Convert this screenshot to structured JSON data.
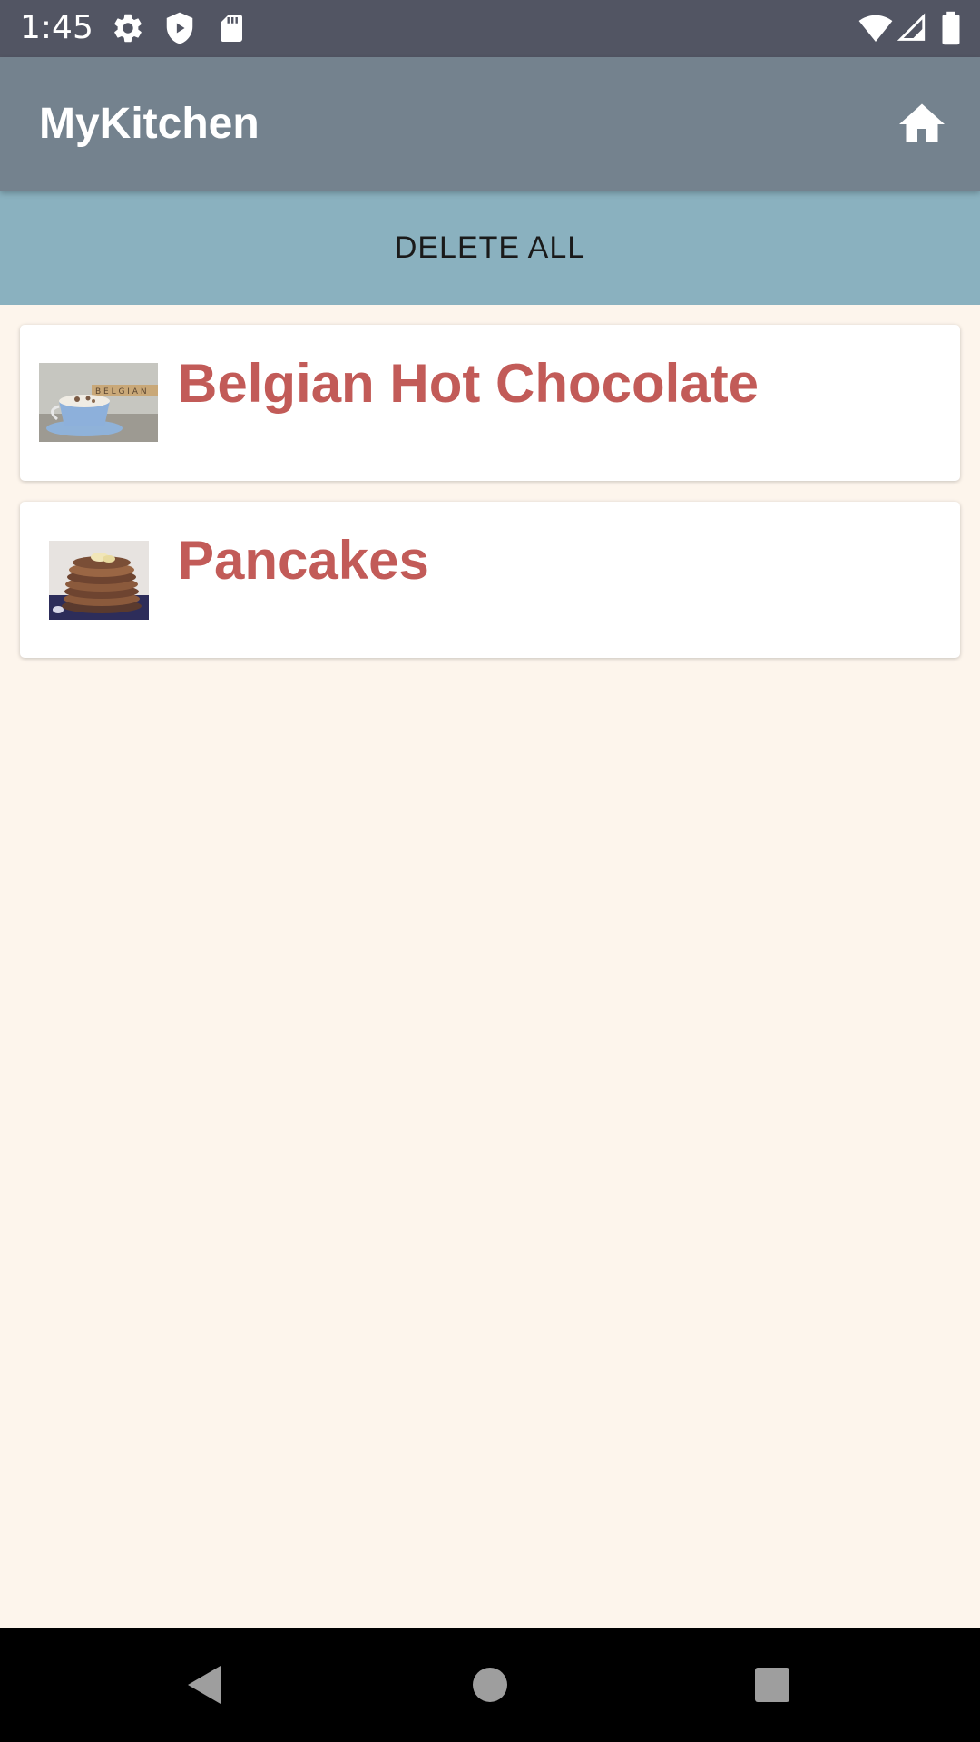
{
  "status_bar": {
    "time": "1:45",
    "icons": [
      "settings-icon",
      "shield-icon",
      "sd-card-icon",
      "wifi-icon",
      "signal-icon",
      "battery-icon"
    ]
  },
  "app_bar": {
    "title": "MyKitchen",
    "home_icon": "home-icon"
  },
  "actions": {
    "delete_all_label": "DELETE ALL"
  },
  "recipes": [
    {
      "title": "Belgian Hot Chocolate",
      "thumbnail": "hot-chocolate-photo"
    },
    {
      "title": "Pancakes",
      "thumbnail": "pancakes-photo"
    }
  ],
  "nav_bar": {
    "icons": [
      "back-icon",
      "home-circle-icon",
      "recents-icon"
    ]
  },
  "colors": {
    "status_bar": "#525563",
    "app_bar": "#74828e",
    "delete_bar": "#8ab1bf",
    "background": "#fdf5ec",
    "recipe_title": "#c25b58"
  }
}
